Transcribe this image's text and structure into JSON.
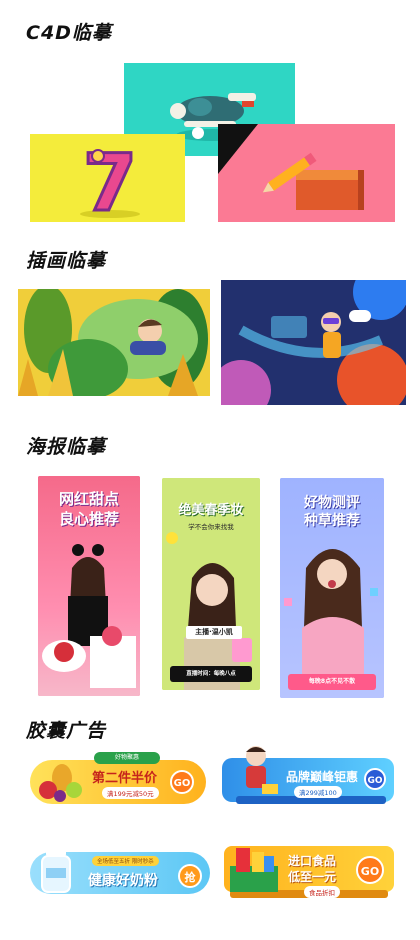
{
  "sections": {
    "c4d": "C4D临摹",
    "illustration": "插画临摹",
    "poster": "海报临摹",
    "capsule": "胶囊广告"
  },
  "colors": {
    "c4d_cyan": "#2fd6c4",
    "c4d_yellow": "#f4ec3b",
    "c4d_pink": "#fb7a94",
    "jungle_green": "#2d8a3a",
    "space_navy": "#22306e",
    "poster_pink": "#f56a8a",
    "poster_lime": "#cfe77a",
    "poster_periwinkle": "#9fb3ff",
    "capsule_orange": "#ffb21d",
    "capsule_blue": "#3aa6ff",
    "capsule_sky": "#5cc7f5",
    "capsule_yellow": "#ffd23a"
  },
  "c4d": {
    "number_glyph": "7"
  },
  "posters": [
    {
      "title_line1": "网红甜点",
      "title_line2": "良心推荐"
    },
    {
      "title_line1": "绝美春季妆",
      "subtitle": "学不会你来找我",
      "name_tag": "主播·温小凯",
      "bar": "直播时间：每晚八点"
    },
    {
      "title_line1": "好物测评",
      "title_line2": "种草推荐",
      "bar": "每晚8点不见不散"
    }
  ],
  "capsules": [
    {
      "tag": "好物聚惠",
      "title": "第二件半价",
      "sub": "满199元减50元",
      "go": "GO"
    },
    {
      "title": "品牌巅峰钜惠",
      "sub": "满299减100",
      "go": "GO"
    },
    {
      "sub": "全场低至五折 限时秒杀",
      "title": "健康好奶粉",
      "go": "抢"
    },
    {
      "title_line1": "进口食品",
      "title_line2": "低至一元",
      "sub": "食品折扣",
      "go": "GO"
    }
  ]
}
